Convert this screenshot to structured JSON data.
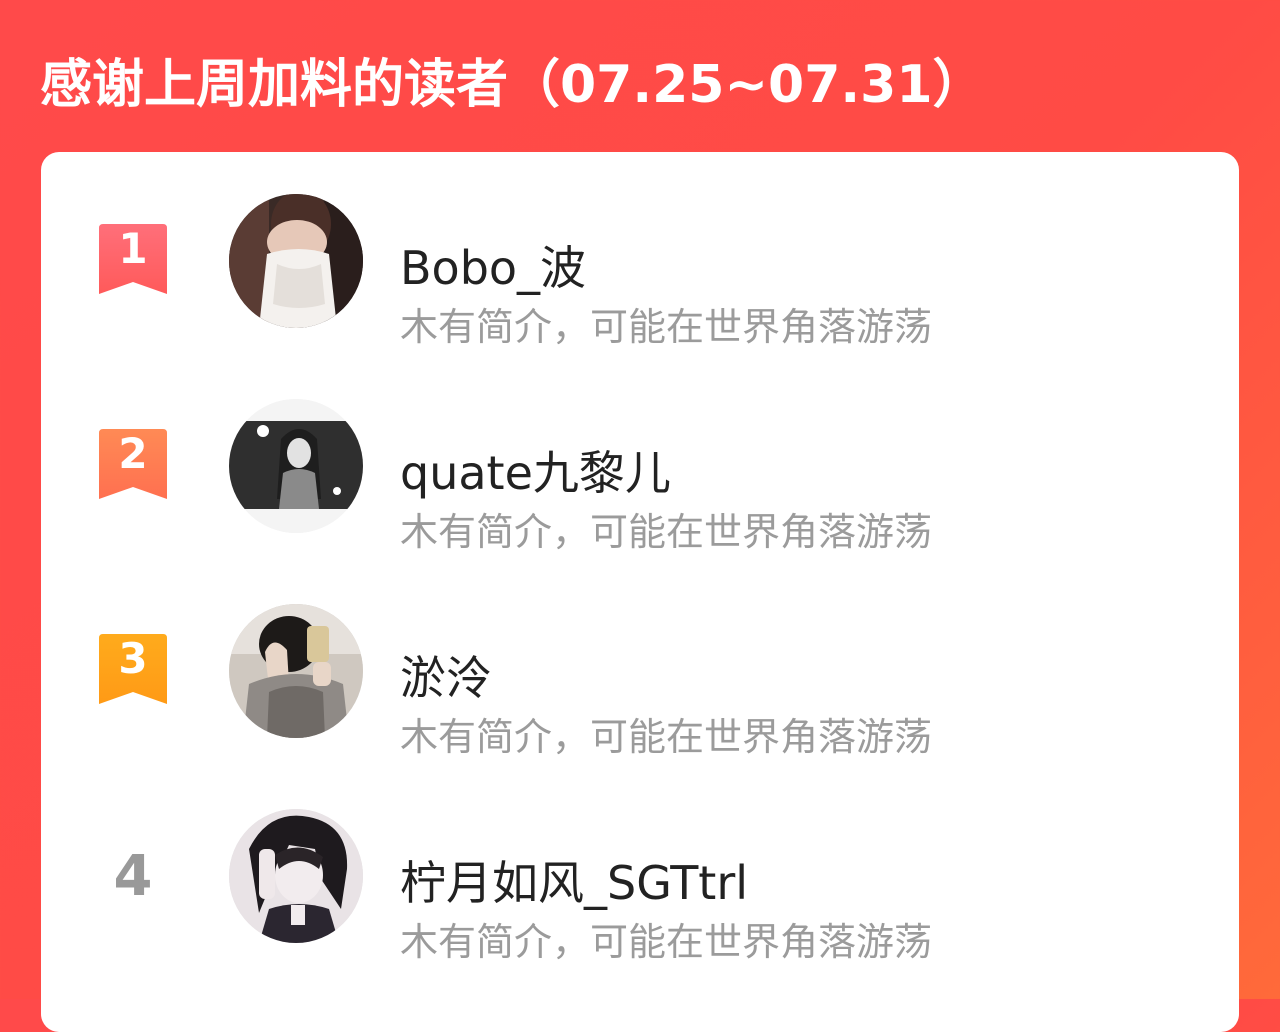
{
  "header": {
    "title": "感谢上周加料的读者（07.25~07.31）"
  },
  "colors": {
    "background": "#ff4a4a",
    "rank1": "#ff5a63",
    "rank2": "#ff7a4d",
    "rank3": "#ffa11a",
    "rank_plain": "#999999"
  },
  "readers": [
    {
      "rank": "1",
      "name": "Bobo_波",
      "desc": "木有简介，可能在世界角落游荡",
      "avatar_icon": "avatar-photo-girl-white-dress"
    },
    {
      "rank": "2",
      "name": "quate九黎儿",
      "desc": "木有简介，可能在世界角落游荡",
      "avatar_icon": "avatar-photo-girl-sparkler"
    },
    {
      "rank": "3",
      "name": "淤泠",
      "desc": "木有简介，可能在世界角落游荡",
      "avatar_icon": "avatar-photo-mirror-selfie"
    },
    {
      "rank": "4",
      "name": "柠月如风_SGTtrl",
      "desc": "木有简介，可能在世界角落游荡",
      "avatar_icon": "avatar-anime-character"
    }
  ]
}
